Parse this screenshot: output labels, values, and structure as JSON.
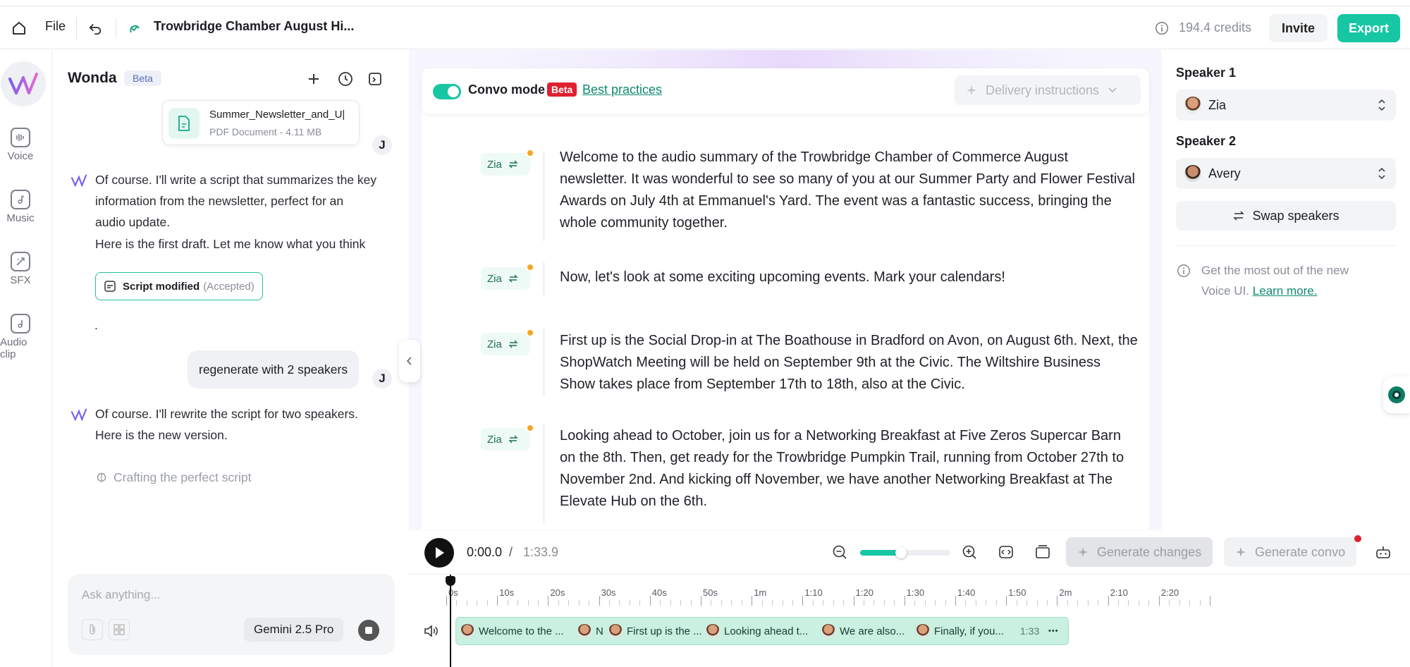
{
  "topbar": {
    "file_label": "File",
    "doc_title": "Trowbridge Chamber August Hi...",
    "credits": "194.4 credits",
    "invite_label": "Invite",
    "export_label": "Export"
  },
  "rail": {
    "items": [
      {
        "label": "Voice",
        "icon": "voice-icon"
      },
      {
        "label": "Music",
        "icon": "music-icon"
      },
      {
        "label": "SFX",
        "icon": "sfx-icon"
      },
      {
        "label": "Audio clip",
        "icon": "audio-clip-icon"
      }
    ]
  },
  "chat": {
    "assistant_name": "Wonda",
    "beta_badge": "Beta",
    "file_name": "Summer_Newsletter_and_U|",
    "file_meta": "PDF Document - 4.11 MB",
    "user_initial": "J",
    "msg1_line1": "Of course. I'll write a script that summarizes the key",
    "msg1_line2": "information from the newsletter, perfect for an",
    "msg1_line3": "audio update.",
    "msg1_line4": "Here is the first draft. Let me know what you think",
    "script_modified": "Script modified",
    "script_status": "(Accepted)",
    "dot_line": ".",
    "user_msg": "regenerate with 2 speakers",
    "msg2_line1": "Of course. I'll rewrite the script for two speakers.",
    "msg2_line2": "Here is the new version.",
    "crafting": "Crafting the perfect script",
    "composer_placeholder": "Ask anything...",
    "model": "Gemini 2.5 Pro"
  },
  "editor": {
    "convo_mode": "Convo mode",
    "convo_badge": "Beta",
    "best_practices": "Best practices",
    "delivery_placeholder": "Delivery instructions",
    "segments": [
      {
        "speaker": "Zia",
        "text": "Welcome to the audio summary of the Trowbridge Chamber of Commerce August newsletter. It was wonderful to see so many of you at our Summer Party and Flower Festival Awards on July 4th at Emmanuel's Yard. The event was a fantastic success, bringing the whole community together."
      },
      {
        "speaker": "Zia",
        "text": "Now, let's look at some exciting upcoming events. Mark your calendars!"
      },
      {
        "speaker": "Zia",
        "text": "First up is the Social Drop-in at The Boathouse in Bradford on Avon, on August 6th. Next, the ShopWatch Meeting will be held on September 9th at the Civic. The Wiltshire Business Show takes place from September 17th to 18th, also at the Civic."
      },
      {
        "speaker": "Zia",
        "text": "Looking ahead to October, join us for a Networking Breakfast at Five Zeros Supercar Barn on the 8th. Then, get ready for the Trowbridge Pumpkin Trail, running from October 27th to November 2nd. And kicking off November, we have another Networking Breakfast at The Elevate Hub on the 6th."
      }
    ]
  },
  "rpanel": {
    "speaker1_label": "Speaker 1",
    "speaker1_value": "Zia",
    "speaker2_label": "Speaker 2",
    "speaker2_value": "Avery",
    "swap_label": "Swap speakers",
    "tip_text": "Get the most out of the new Voice UI.",
    "learn_more": "Learn more."
  },
  "playback": {
    "current_time": "0:00.0",
    "separator": "/",
    "total_time": "1:33.9",
    "zoom_level": 0.45,
    "generate_changes": "Generate changes",
    "generate_convo": "Generate convo"
  },
  "timeline": {
    "ticks": [
      "0s",
      "10s",
      "20s",
      "30s",
      "40s",
      "50s",
      "1m",
      "1:10",
      "1:20",
      "1:30",
      "1:40",
      "1:50",
      "2m",
      "2:10",
      "2:20"
    ],
    "clips": [
      "Welcome to the ...",
      "N",
      "First up is the ...",
      "Looking ahead t...",
      "We are also...",
      "Finally, if you..."
    ],
    "track_duration": "1:33",
    "more": "•••"
  },
  "colors": {
    "accent": "#17c7a4",
    "beta_red": "#e0202f",
    "link_green": "#0f8a6e"
  }
}
